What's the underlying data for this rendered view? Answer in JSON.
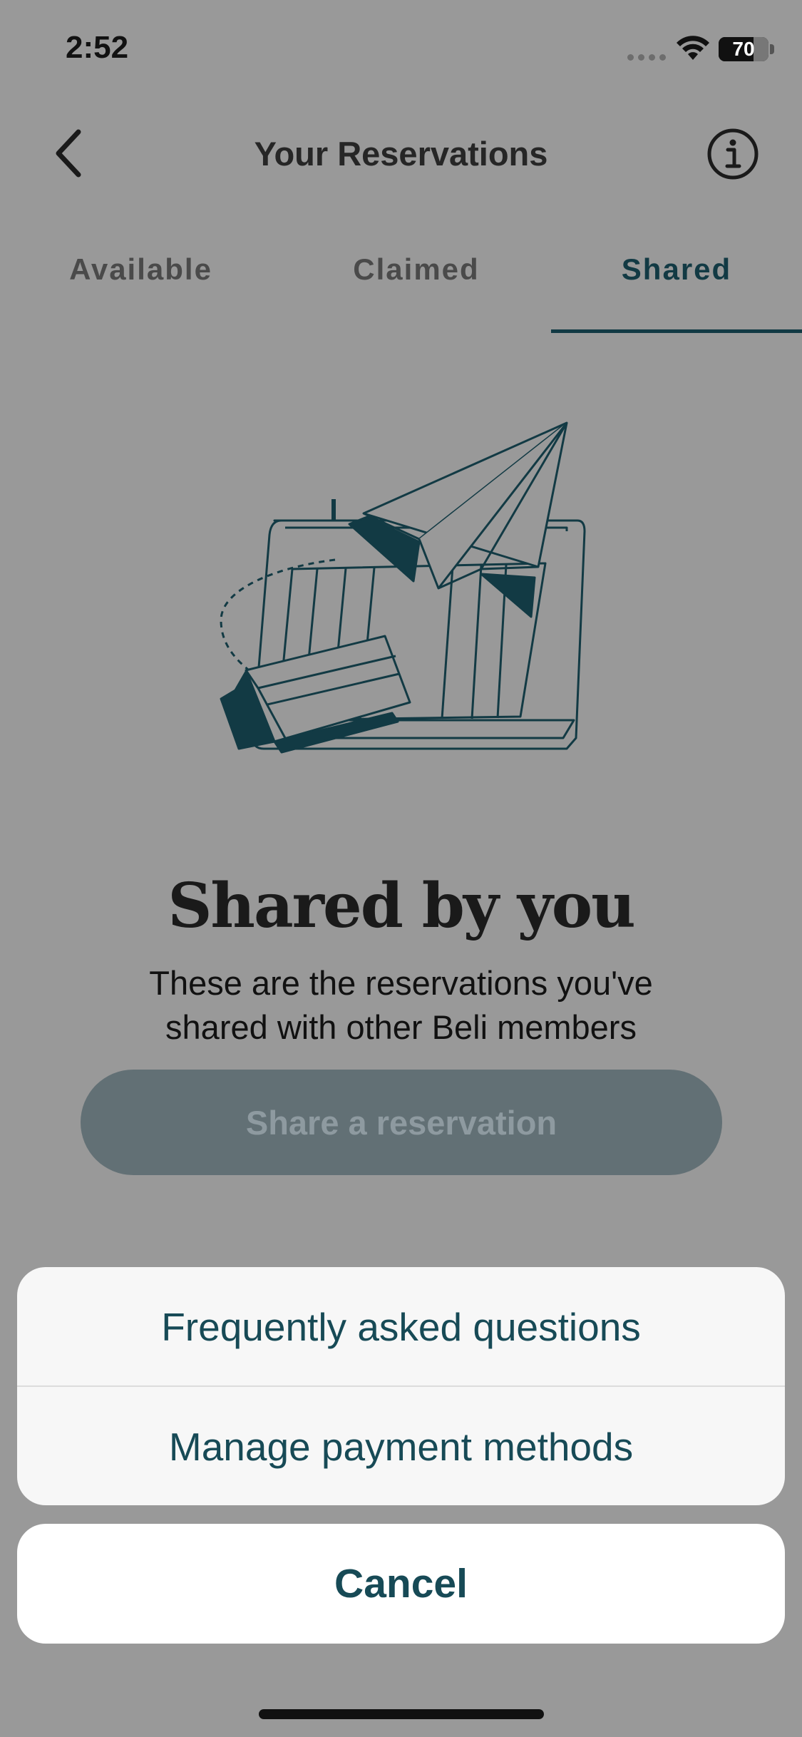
{
  "status_bar": {
    "time": "2:52",
    "battery_label": "70",
    "battery_level": 0.7,
    "wifi_icon": "wifi-icon",
    "signal_icon": "cellular-signal-icon"
  },
  "header": {
    "title": "Your Reservations",
    "back_icon": "chevron-left-icon",
    "info_icon": "info-circle-icon"
  },
  "tabs": [
    {
      "label": "Available",
      "active": false
    },
    {
      "label": "Claimed",
      "active": false
    },
    {
      "label": "Shared",
      "active": true
    }
  ],
  "empty_state": {
    "illustration": "paper-plane-over-reservation-book-illustration",
    "title": "Shared by you",
    "description": "These are the reservations you've shared with other Beli members",
    "button_label": "Share a reservation"
  },
  "action_sheet": {
    "items": [
      {
        "label": "Frequently asked questions"
      },
      {
        "label": "Manage payment methods"
      }
    ],
    "cancel_label": "Cancel"
  },
  "colors": {
    "accent": "#123a44",
    "sheet_text": "#174a56",
    "overlay_background": "#999999",
    "disabled_button": "#627075"
  }
}
